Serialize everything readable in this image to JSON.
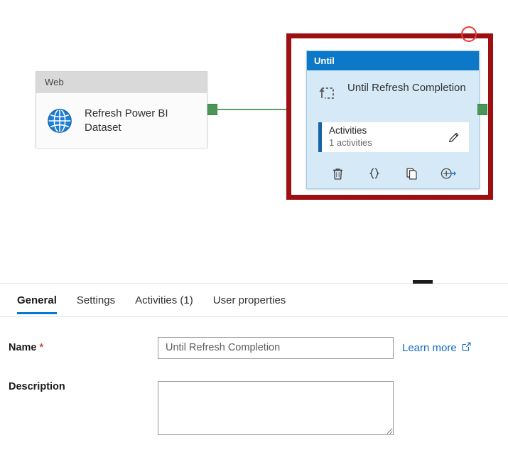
{
  "canvas": {
    "web_node": {
      "header": "Web",
      "title": "Refresh Power BI Dataset",
      "icon": "globe-icon"
    },
    "until_node": {
      "header": "Until",
      "title": "Until Refresh Completion",
      "icon": "loop-icon",
      "activities": {
        "label": "Activities",
        "count_text": "1 activities",
        "edit_icon": "pencil-icon"
      },
      "actions": [
        {
          "name": "delete-activity-button",
          "icon": "trash-icon",
          "glyph": "trash"
        },
        {
          "name": "view-code-button",
          "icon": "code-braces-icon",
          "glyph": "{}"
        },
        {
          "name": "clone-activity-button",
          "icon": "copy-icon",
          "glyph": "copy"
        },
        {
          "name": "add-output-button",
          "icon": "add-output-arrow-icon",
          "glyph": "add-arrow"
        }
      ]
    },
    "selection": {
      "marker_icon": "circle-annotation-icon",
      "border_color": "#9e0f12",
      "circle_color": "#e8393c"
    },
    "connector": {
      "color": "#5b9e63",
      "handle_color": "#4a9656"
    }
  },
  "panel": {
    "grabber_name": "panel-resize-grabber",
    "tabs": [
      {
        "label": "General",
        "active": true
      },
      {
        "label": "Settings",
        "active": false
      },
      {
        "label": "Activities (1)",
        "active": false
      },
      {
        "label": "User properties",
        "active": false
      }
    ],
    "fields": {
      "name": {
        "label": "Name",
        "required_marker": "*",
        "value": "Until Refresh Completion",
        "placeholder": ""
      },
      "description": {
        "label": "Description",
        "value": "",
        "placeholder": ""
      }
    },
    "learn_more": {
      "label": "Learn more",
      "icon": "external-link-icon"
    }
  },
  "colors": {
    "accent_blue": "#0078d4",
    "until_header": "#0d78c8",
    "until_body": "#d6e9f7",
    "web_header": "#d9d9d9",
    "link_blue": "#1668c1"
  }
}
